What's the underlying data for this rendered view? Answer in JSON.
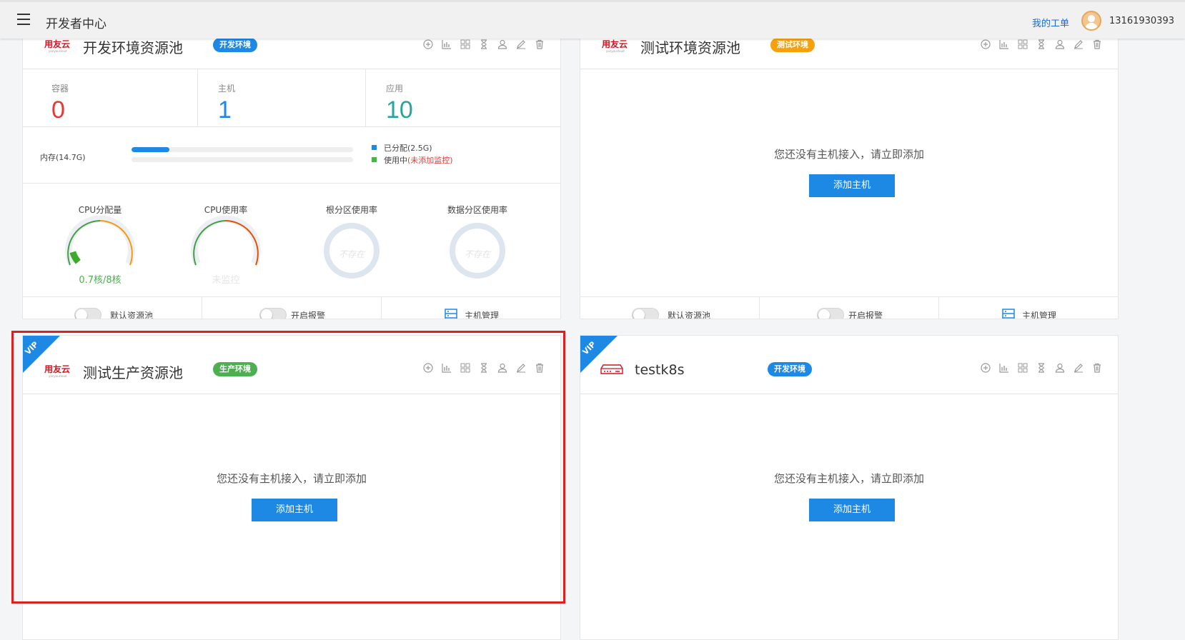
{
  "header": {
    "title": "开发者中心",
    "my_orders": "我的工单",
    "user_phone": "13161930393"
  },
  "common": {
    "logo_text": "用友云",
    "logo_sub": "yonyoucloud",
    "empty_message": "您还没有主机接入，请立即添加",
    "add_host_label": "添加主机",
    "default_pool_label": "默认资源池",
    "alarm_label": "开启报警",
    "host_manage_label": "主机管理",
    "vip_label": "VIP"
  },
  "pools": [
    {
      "name": "开发环境资源池",
      "env": "开发环境",
      "env_color": "#1e88e5",
      "stats": [
        {
          "label": "容器",
          "value": "0",
          "color": "#e53935"
        },
        {
          "label": "主机",
          "value": "1",
          "color": "#1e88e5"
        },
        {
          "label": "应用",
          "value": "10",
          "color": "#26a69a"
        }
      ],
      "memory": {
        "label": "内存(14.7G)",
        "allocated_fraction": 0.17,
        "allocated_label": "已分配(2.5G)",
        "in_use_label": "使用中",
        "in_use_note": "(未添加监控)"
      },
      "gauges": [
        {
          "title": "CPU分配量",
          "value": "0.7核/8核",
          "level": 0.0875
        },
        {
          "title": "CPU使用率",
          "value": "未监控"
        },
        {
          "title": "根分区使用率",
          "value": "不存在"
        },
        {
          "title": "数据分区使用率",
          "value": "不存在"
        }
      ]
    },
    {
      "name": "测试环境资源池",
      "env": "测试环境",
      "env_color": "#f5a10c"
    },
    {
      "name": "测试生产资源池",
      "env": "生产环境",
      "env_color": "#4caf50"
    },
    {
      "name": "testk8s",
      "env": "开发环境",
      "env_color": "#1e88e5"
    }
  ]
}
